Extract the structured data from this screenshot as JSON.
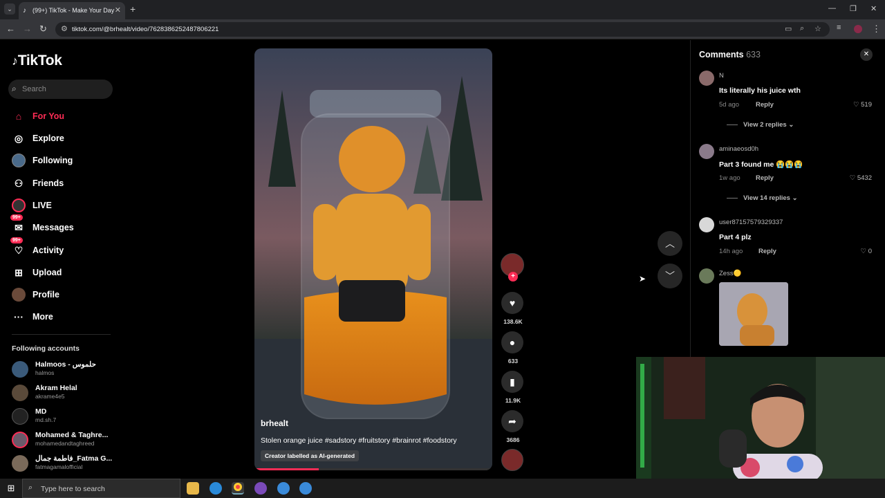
{
  "browser": {
    "tab_title": "(99+) TikTok - Make Your Day",
    "tab_favicon": "tiktok-icon",
    "new_tab": "+",
    "url": "tiktok.com/@brhealt/video/7628386252487806221"
  },
  "sidebar": {
    "logo": "TikTok",
    "search_placeholder": "Search",
    "nav": [
      {
        "label": "For You",
        "icon": "home-icon",
        "active": true
      },
      {
        "label": "Explore",
        "icon": "compass-icon"
      },
      {
        "label": "Following",
        "icon": "following-avatar-icon"
      },
      {
        "label": "Friends",
        "icon": "friends-icon"
      },
      {
        "label": "LIVE",
        "icon": "live-icon"
      },
      {
        "label": "Messages",
        "icon": "messages-icon",
        "badge": "99+"
      },
      {
        "label": "Activity",
        "icon": "activity-icon",
        "badge": "99+"
      },
      {
        "label": "Upload",
        "icon": "upload-icon"
      },
      {
        "label": "Profile",
        "icon": "profile-avatar-icon"
      },
      {
        "label": "More",
        "icon": "more-icon"
      }
    ],
    "following_title": "Following accounts",
    "accounts": [
      {
        "name": "Halmoos - حلموس",
        "handle": "halmos"
      },
      {
        "name": "Akram Helal",
        "handle": "akrame4e5"
      },
      {
        "name": "MD",
        "handle": "md.sh.7"
      },
      {
        "name": "Mohamed & Taghre...",
        "handle": "mohamedandtaghreed"
      },
      {
        "name": "فاطمة جمال_Fatma G...",
        "handle": "fatmagamalofficial"
      }
    ]
  },
  "video": {
    "author": "brhealt",
    "caption": "Stolen orange juice #sadstory #fruitstory #brainrot #foodstory",
    "ai_label": "Creator labelled as AI-generated",
    "progress": 0.27
  },
  "actions": {
    "likes": "138.6K",
    "comments": "633",
    "saves": "11.9K",
    "shares": "3686"
  },
  "comments_panel": {
    "title": "Comments",
    "count": "633",
    "items": [
      {
        "user": "N",
        "text": "Its literally his juice wth",
        "time": "5d ago",
        "reply": "Reply",
        "likes": "519",
        "view_replies": "View 2 replies"
      },
      {
        "user": "aminaeosd0h",
        "text": "Part 3 found me 😭😭😭",
        "time": "1w ago",
        "reply": "Reply",
        "likes": "5432",
        "view_replies": "View 14 replies"
      },
      {
        "user": "user87157579329337",
        "text": "Part 4 plz",
        "time": "14h ago",
        "reply": "Reply",
        "likes": "0"
      },
      {
        "user": "Zess🟡"
      }
    ]
  },
  "taskbar": {
    "search_placeholder": "Type here to search"
  },
  "colors": {
    "accent": "#fe2c55",
    "background": "#000000"
  }
}
